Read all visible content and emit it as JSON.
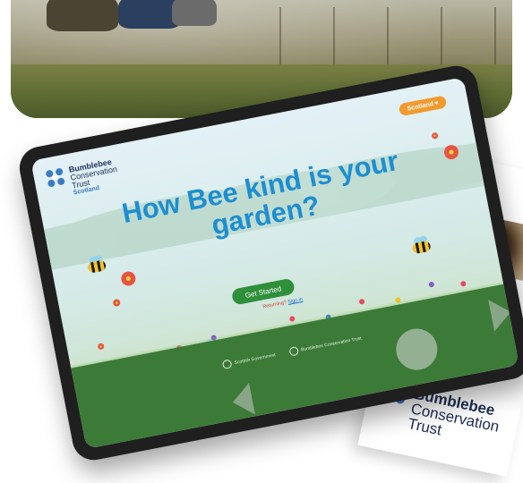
{
  "tablet_screen": {
    "logo": {
      "line1": "Bumblebee",
      "line2": "Conservation",
      "line3": "Trust",
      "region": "Scotland"
    },
    "region_selector": "Scotland ▾",
    "title_line1": "How Bee kind is your",
    "title_line2": "garden?",
    "cta_label": "Get Started",
    "returning_prefix": "Returning?",
    "returning_link": "Sign in",
    "footer": {
      "partner_label": "Scottish Government",
      "footer_logo_label": "Bumblebee Conservation Trust"
    }
  },
  "leaflet": {
    "logo_line1": "Bumblebee",
    "logo_line2": "Conservation",
    "logo_line3": "Trust"
  },
  "colors": {
    "title_blue": "#1d8ed1",
    "cta_green": "#2f8f3a",
    "footer_green": "#3c7a38",
    "accent_orange": "#f39a2e"
  }
}
